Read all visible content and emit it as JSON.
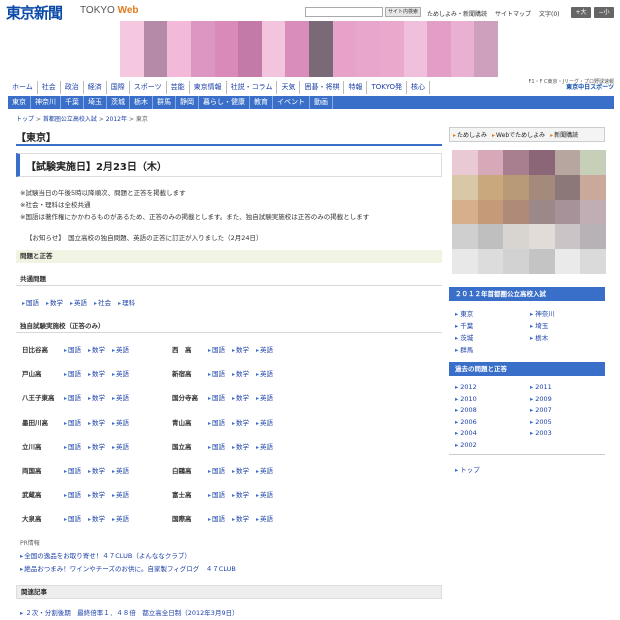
{
  "header": {
    "logo": "東京新聞",
    "logo_sub_a": "TOKYO ",
    "logo_sub_b": "Web",
    "search_button": "サイト内検索",
    "links": [
      "ためしよみ・新聞購読",
      "サイトマップ"
    ],
    "font_label": "文字",
    "font_reset": "(0)",
    "font_plus": "+大",
    "font_minus": "−小"
  },
  "sponsor": {
    "line1": "F1・F C東京・Jリーグ・プロ野球速報",
    "line2": "東京中日スポーツ"
  },
  "nav_main": [
    "ホーム",
    "社会",
    "政治",
    "経済",
    "国際",
    "スポーツ",
    "芸能",
    "東京情報",
    "社説・コラム",
    "天気",
    "囲碁・将棋",
    "特報",
    "TOKYO発",
    "核心"
  ],
  "nav_sub": [
    "東京",
    "神奈川",
    "千葉",
    "埼玉",
    "茨城",
    "栃木",
    "群馬",
    "静岡",
    "暮らし・健康",
    "教育",
    "イベント",
    "動画"
  ],
  "breadcrumb": {
    "items": [
      "トップ",
      "首都圏公立高校入試",
      "2012年"
    ],
    "current": "東京"
  },
  "page_title": "【東京】",
  "exam_heading": "【試験実施日】2月23日（木）",
  "notes": [
    "※試験当日の午後5時以降順次、問題と正答を掲載します",
    "※社会・理科は全校共通",
    "※国語は著作権にかかわるものがあるため、正答のみの掲載とします。また、独自試験実施校は正答のみの掲載とします"
  ],
  "notice": "【お知らせ】　国立高校の独自問題、英語の正答に訂正が入りました（2月24日）",
  "section_title": "問題と正答",
  "common_heading": "共通問題",
  "common_subjects": [
    "国語",
    "数学",
    "英語",
    "社会",
    "理科"
  ],
  "indep_heading": "独自試験実施校（正答のみ）",
  "schools": [
    {
      "name": "日比谷高",
      "subjects": [
        "国語",
        "数学",
        "英語"
      ]
    },
    {
      "name": "西　高",
      "subjects": [
        "国語",
        "数学",
        "英語"
      ]
    },
    {
      "name": "戸山高",
      "subjects": [
        "国語",
        "数学",
        "英語"
      ]
    },
    {
      "name": "新宿高",
      "subjects": [
        "国語",
        "数学",
        "英語"
      ]
    },
    {
      "name": "八王子東高",
      "subjects": [
        "国語",
        "数学",
        "英語"
      ]
    },
    {
      "name": "国分寺高",
      "subjects": [
        "国語",
        "数学",
        "英語"
      ]
    },
    {
      "name": "墨田川高",
      "subjects": [
        "国語",
        "数学",
        "英語"
      ]
    },
    {
      "name": "青山高",
      "subjects": [
        "国語",
        "数学",
        "英語"
      ]
    },
    {
      "name": "立川高",
      "subjects": [
        "国語",
        "数学",
        "英語"
      ]
    },
    {
      "name": "国立高",
      "subjects": [
        "国語",
        "数学",
        "英語"
      ]
    },
    {
      "name": "両国高",
      "subjects": [
        "国語",
        "数学",
        "英語"
      ]
    },
    {
      "name": "白鷗高",
      "subjects": [
        "国語",
        "数学",
        "英語"
      ]
    },
    {
      "name": "武蔵高",
      "subjects": [
        "国語",
        "数学",
        "英語"
      ]
    },
    {
      "name": "富士高",
      "subjects": [
        "国語",
        "数学",
        "英語"
      ]
    },
    {
      "name": "大泉高",
      "subjects": [
        "国語",
        "数学",
        "英語"
      ]
    },
    {
      "name": "国際高",
      "subjects": [
        "国語",
        "数学",
        "英語"
      ]
    }
  ],
  "pr": {
    "label": "PR情報",
    "items": [
      "全国の逸品をお取り寄せ！４７CLUB（よんななクラブ）",
      "絶品おつまみ！ワインやチーズのお供に。自家製フィグログ　４７CLUB"
    ]
  },
  "related": {
    "title": "関連記事",
    "item": "２次・分割後期　最終倍率１．４８倍　都立高全日制（2012年3月9日）"
  },
  "sidebar": {
    "tools": [
      "ためしよみ",
      "Webでためしよみ",
      "新聞購読"
    ],
    "pref_title": "２０１２年首都圏公立高校入試",
    "prefs": [
      "東京",
      "神奈川",
      "千葉",
      "埼玉",
      "茨城",
      "栃木",
      "群馬"
    ],
    "past_title": "過去の問題と正答",
    "years": [
      "2012",
      "2011",
      "2010",
      "2009",
      "2008",
      "2007",
      "2006",
      "2005",
      "2004",
      "2003",
      "2002"
    ],
    "top_link": "トップ"
  },
  "colors": {
    "brand": "#0b4aa8",
    "nav": "#3a6fc9",
    "accent": "#e07a1f"
  }
}
